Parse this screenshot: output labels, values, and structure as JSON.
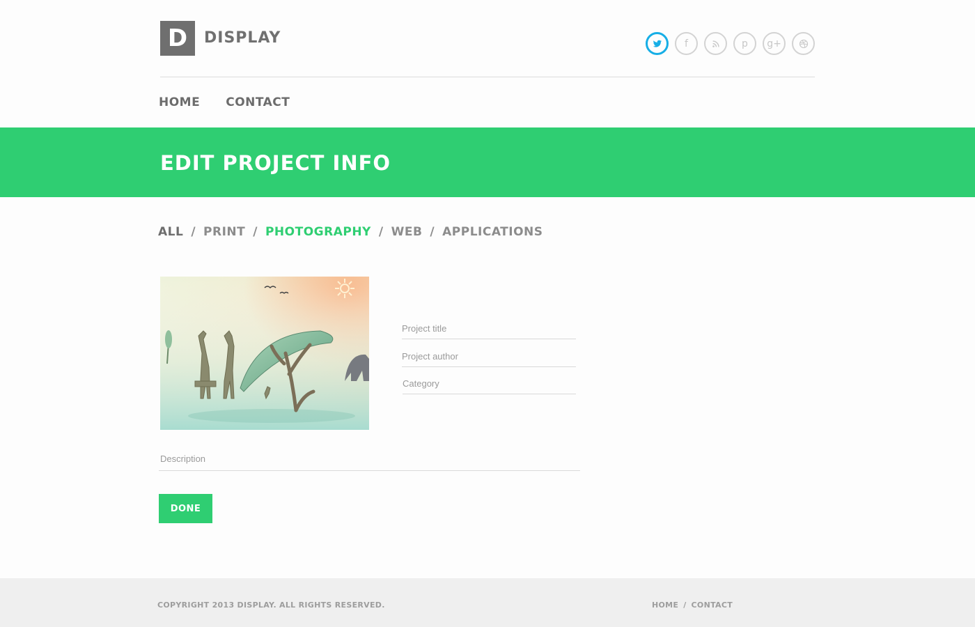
{
  "brand": {
    "logo_letter": "D",
    "name": "DISPLAY"
  },
  "social": [
    {
      "icon": "twitter-icon",
      "glyph": "",
      "active": true
    },
    {
      "icon": "facebook-icon",
      "glyph": "f"
    },
    {
      "icon": "rss-icon",
      "glyph": ""
    },
    {
      "icon": "pinterest-icon",
      "glyph": "p"
    },
    {
      "icon": "google-plus-icon",
      "glyph": "g+"
    },
    {
      "icon": "dribbble-icon",
      "glyph": ""
    }
  ],
  "nav": {
    "home": "HOME",
    "contact": "CONTACT"
  },
  "banner": {
    "title": "EDIT PROJECT INFO"
  },
  "filters": {
    "items": [
      "ALL",
      "PRINT",
      "PHOTOGRAPHY",
      "WEB",
      "APPLICATIONS"
    ],
    "active": "PHOTOGRAPHY",
    "separator": "/"
  },
  "form": {
    "title_placeholder": "Project title",
    "author_placeholder": "Project author",
    "category_placeholder": "Category",
    "description_placeholder": "Description",
    "done_label": "DONE"
  },
  "footer": {
    "copyright": "COPYRIGHT 2013 DISPLAY. ALL RIGHTS RESERVED.",
    "home": "HOME",
    "separator": "/",
    "contact": "CONTACT"
  },
  "colors": {
    "accent": "#2fce72",
    "twitter": "#16aee6",
    "logo_bg": "#6f6f6f",
    "footer_bg": "#efefef"
  }
}
